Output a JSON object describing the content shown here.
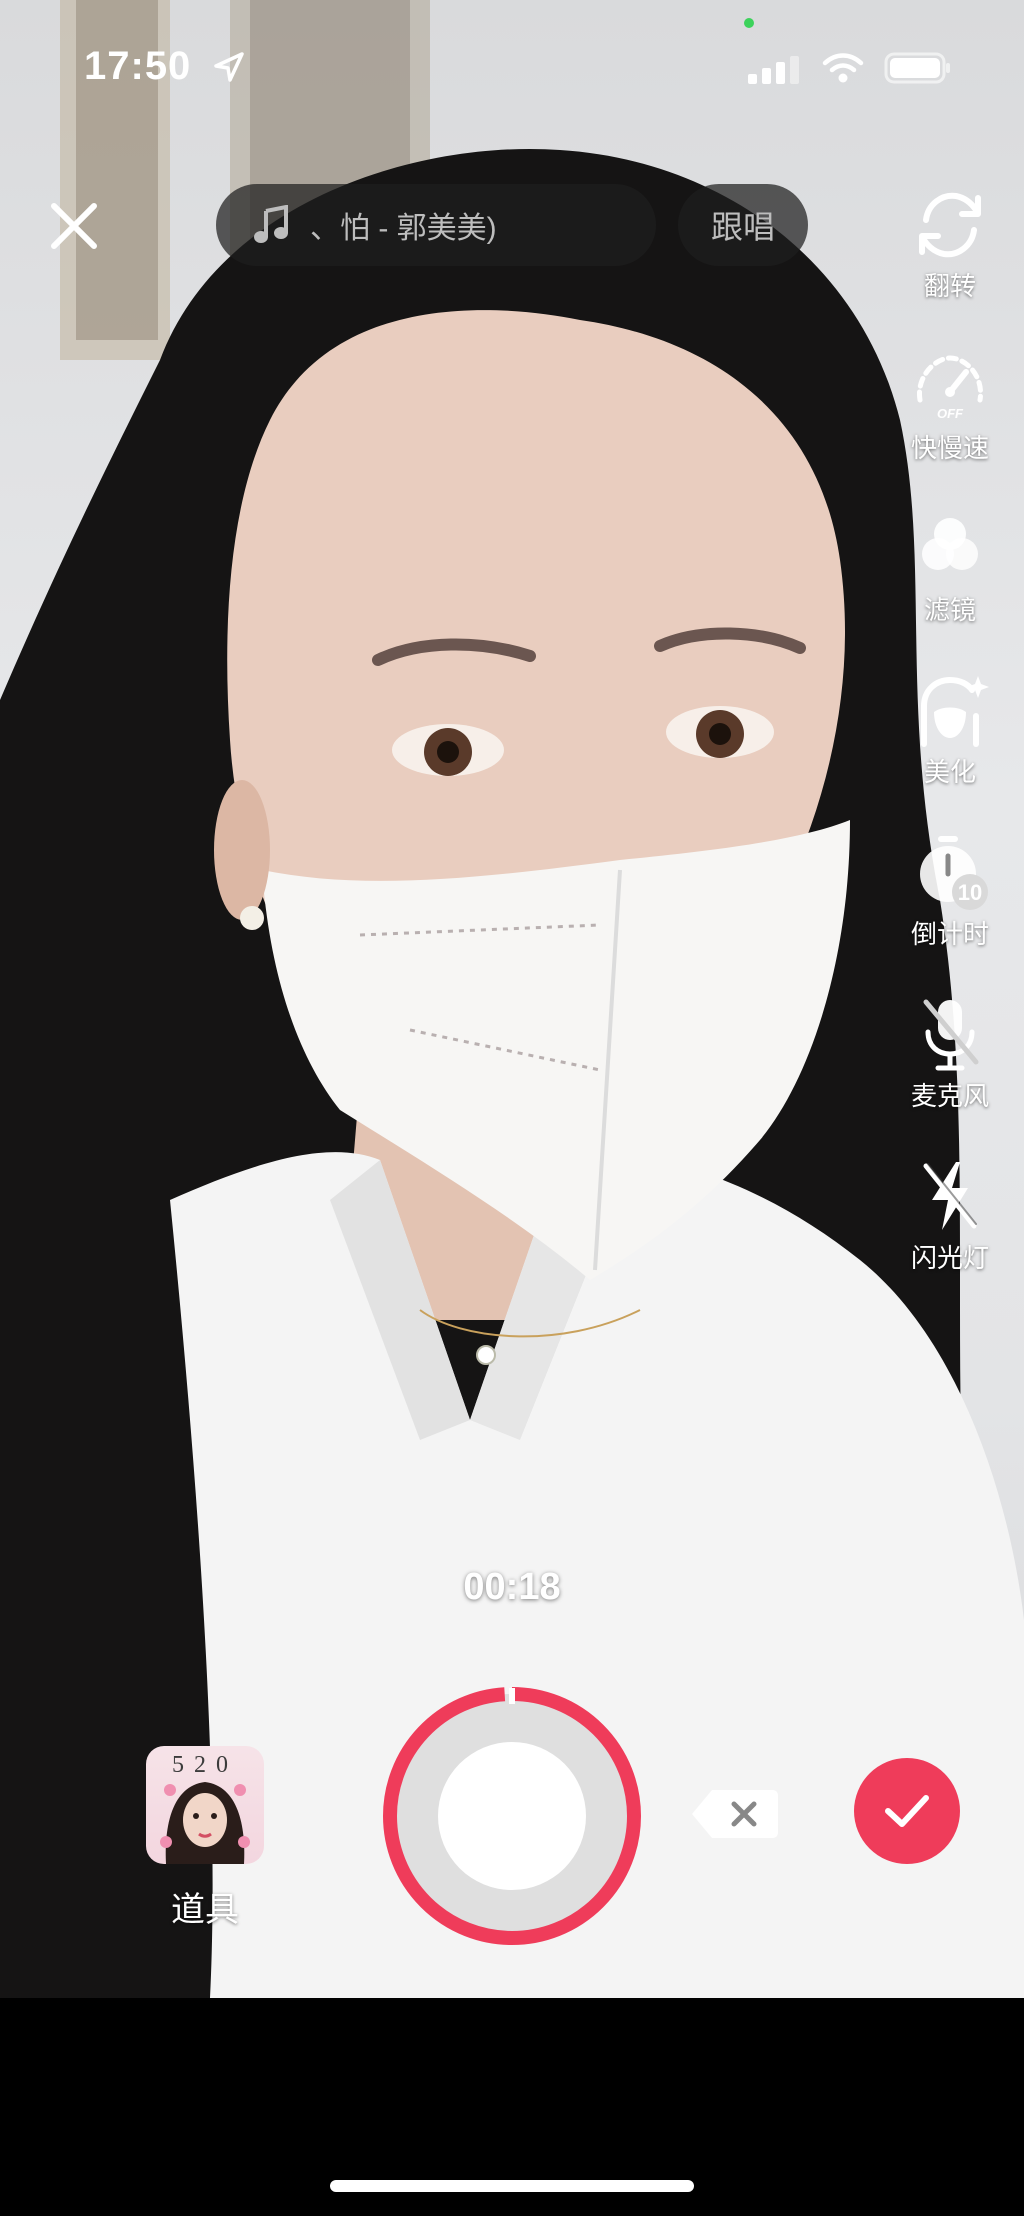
{
  "status_bar": {
    "time": "17:50",
    "icons": [
      "location-arrow-icon",
      "cellular-signal-icon",
      "wifi-icon",
      "battery-icon"
    ]
  },
  "top": {
    "close_icon": "close-icon",
    "music": {
      "icon": "music-note-icon",
      "title": "、怕 - 郭美美)"
    },
    "duet_label": "跟唱"
  },
  "tools": [
    {
      "id": "flip",
      "icon": "flip-camera-icon",
      "label": "翻转"
    },
    {
      "id": "speed",
      "icon": "speed-gauge-icon",
      "label": "快慢速",
      "badge": "OFF"
    },
    {
      "id": "filter",
      "icon": "filter-icon",
      "label": "滤镜"
    },
    {
      "id": "beautify",
      "icon": "beautify-icon",
      "label": "美化"
    },
    {
      "id": "countdown",
      "icon": "countdown-timer-icon",
      "label": "倒计时",
      "badge": "10"
    },
    {
      "id": "mic",
      "icon": "microphone-off-icon",
      "label": "麦克风"
    },
    {
      "id": "flash",
      "icon": "flash-off-icon",
      "label": "闪光灯"
    }
  ],
  "recording": {
    "timer": "00:18",
    "props_label": "道具",
    "props_thumb_text": "520",
    "progress": 0.01,
    "accent_color": "#ef3c5a"
  }
}
